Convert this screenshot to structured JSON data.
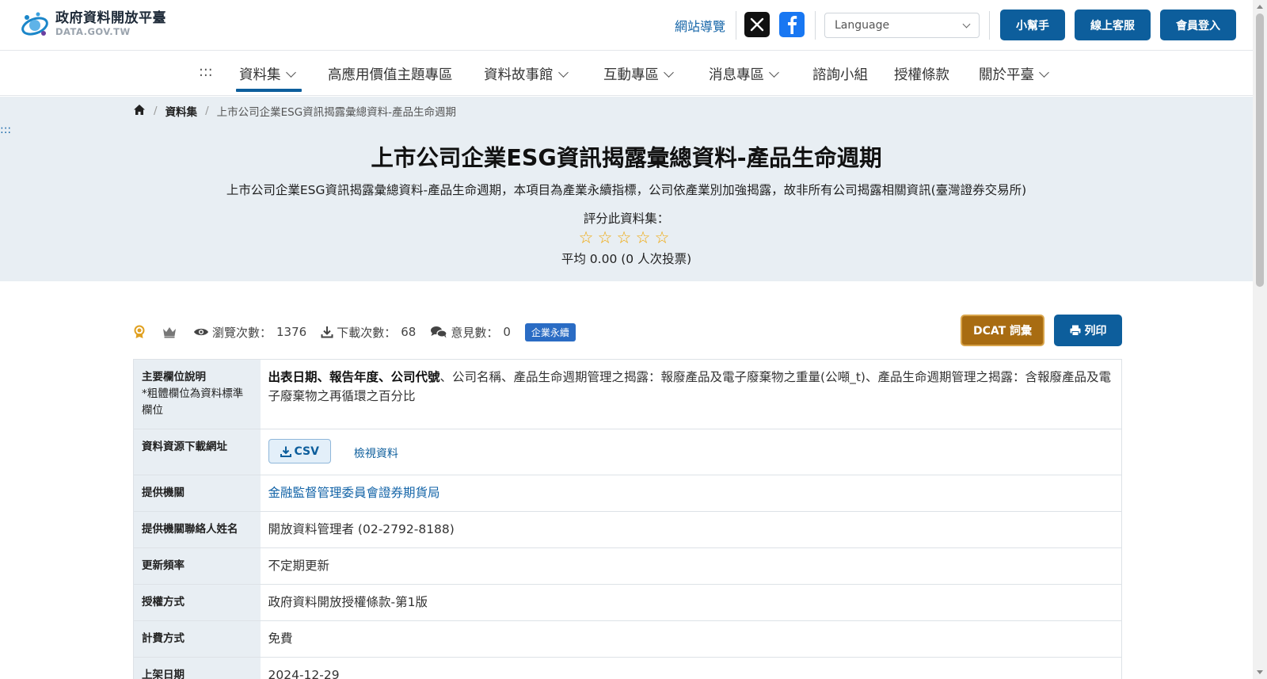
{
  "header": {
    "logo_title": "政府資料開放平臺",
    "logo_sub": "DATA.GOV.TW",
    "sitemap_label": "網站導覽",
    "language_placeholder": "Language",
    "helper_label": "小幫手",
    "service_label": "線上客服",
    "login_label": "會員登入"
  },
  "nav": {
    "accesskey": ":::",
    "items": [
      {
        "label": "資料集"
      },
      {
        "label": "高應用價值主題專區"
      },
      {
        "label": "資料故事館"
      },
      {
        "label": "互動專區"
      },
      {
        "label": "消息專區"
      },
      {
        "label": "諮詢小組"
      },
      {
        "label": "授權條款"
      },
      {
        "label": "關於平臺"
      }
    ]
  },
  "breadcrumb": {
    "sep": "/",
    "dataset": "資料集",
    "current": "上市公司企業ESG資訊揭露彙總資料-產品生命週期"
  },
  "hero": {
    "accesskey": ":::",
    "title": "上市公司企業ESG資訊揭露彙總資料-產品生命週期",
    "description": "上市公司企業ESG資訊揭露彙總資料-產品生命週期，本項目為產業永續指標，公司依產業別加強揭露，故非所有公司揭露相關資訊(臺灣證券交易所)",
    "rate_label": "評分此資料集：",
    "rating": 0,
    "rate_avg": "平均 0.00 (0 人次投票)"
  },
  "stats": {
    "views_label": "瀏覽次數：",
    "views": "1376",
    "downloads_label": "下載次數：",
    "downloads": "68",
    "comments_label": "意見數：",
    "comments": "0",
    "tag": "企業永續",
    "dcat_label": "DCAT 詞彙",
    "print_label": "列印"
  },
  "info": {
    "fields_label": "主要欄位說明",
    "fields_note": "*粗體欄位為資料標準欄位",
    "fields_bold": "出表日期、報告年度、公司代號",
    "fields_rest": "、公司名稱、產品生命週期管理之揭露：報廢產品及電子廢棄物之重量(公噸_t)、產品生命週期管理之揭露：含報廢產品及電子廢棄物之再循環之百分比",
    "resource_label": "資料資源下載網址",
    "csv_label": "CSV",
    "view_label": "檢視資料",
    "provider_label": "提供機關",
    "provider": "金融監督管理委員會證券期貨局",
    "contact_label": "提供機關聯絡人姓名",
    "contact": "開放資料管理者 (02-2792-8188)",
    "frequency_label": "更新頻率",
    "frequency": "不定期更新",
    "license_label": "授權方式",
    "license": "政府資料開放授權條款-第1版",
    "fee_label": "計費方式",
    "fee": "免費",
    "date_label": "上架日期",
    "date": "2024-12-29"
  },
  "colors": {
    "primary": "#0d5e9c",
    "dcat": "#a86c12",
    "hero_bg": "#e8eef3",
    "star": "#f0a500",
    "tag": "#2a6cc4"
  }
}
